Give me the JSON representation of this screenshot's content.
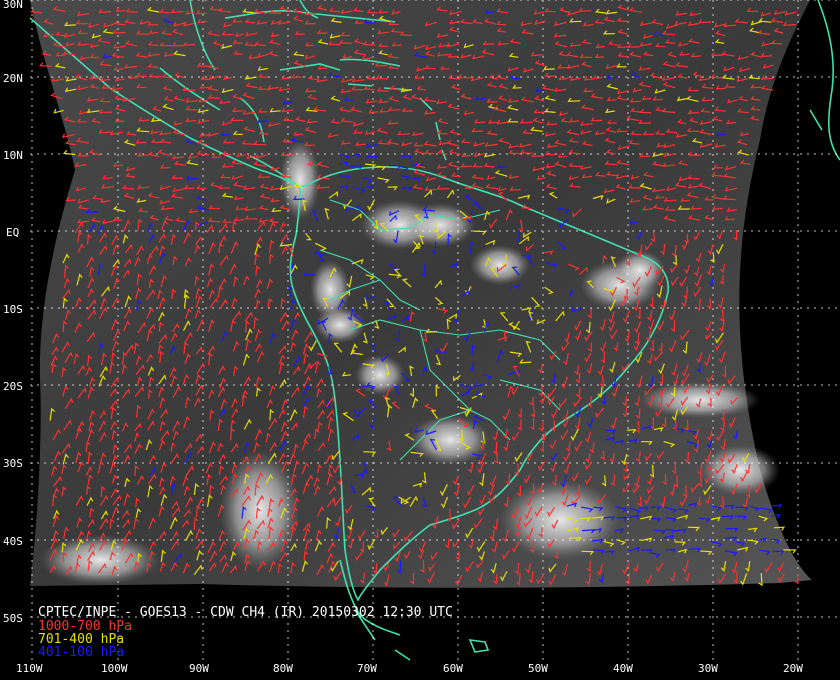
{
  "caption": "CPTEC/INPE - GOES13 - CDW CH4 (IR) 20150302 12:30 UTC",
  "legend": [
    {
      "label": "1000-700 hPa",
      "color": "#ff3030"
    },
    {
      "label": "701-400 hPa",
      "color": "#e8e000"
    },
    {
      "label": "401-100 hPa",
      "color": "#1a1aff"
    }
  ],
  "lat_labels": [
    "30N",
    "20N",
    "10N",
    "EQ",
    "10S",
    "20S",
    "30S",
    "40S",
    "50S"
  ],
  "lon_labels": [
    "110W",
    "100W",
    "90W",
    "80W",
    "70W",
    "60W",
    "50W",
    "40W",
    "30W",
    "20W"
  ],
  "colors": {
    "background": "#000000",
    "coastline": "#40e0b0",
    "grid": "#ffffff",
    "low_level_wind": "#ff3030",
    "mid_level_wind": "#e8e000",
    "high_level_wind": "#1a1aff"
  }
}
